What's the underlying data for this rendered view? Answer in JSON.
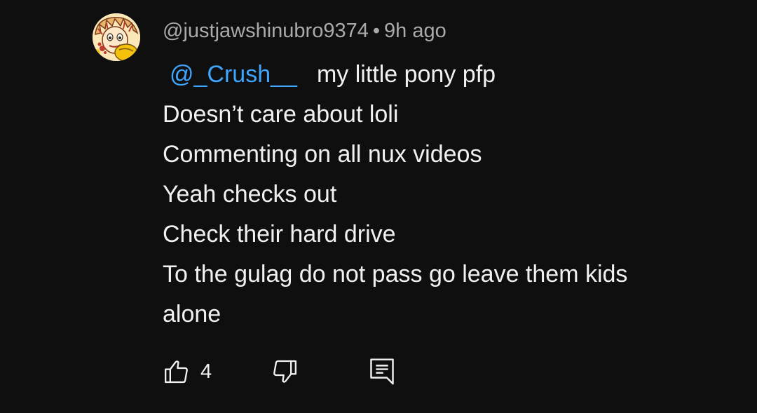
{
  "comment": {
    "author": "@justjawshinubro9374",
    "separator": "•",
    "time": "9h ago",
    "mention": "@_Crush__",
    "first_line_text": "my little pony pfp",
    "lines": [
      "Doesn’t care about loli",
      "Commenting on all nux videos",
      "Yeah checks out",
      "Check their hard drive",
      "To the gulag do not pass go leave them kids",
      "alone"
    ],
    "like_count": "4"
  },
  "icons": {
    "like": "thumbs-up-icon",
    "dislike": "thumbs-down-icon",
    "reply": "reply-comment-icon",
    "avatar": "cartoon-face-avatar"
  },
  "colors": {
    "background": "#0f0f0f",
    "text": "#f1f1f1",
    "meta": "#aaaaaa",
    "mention": "#3ea6ff"
  }
}
